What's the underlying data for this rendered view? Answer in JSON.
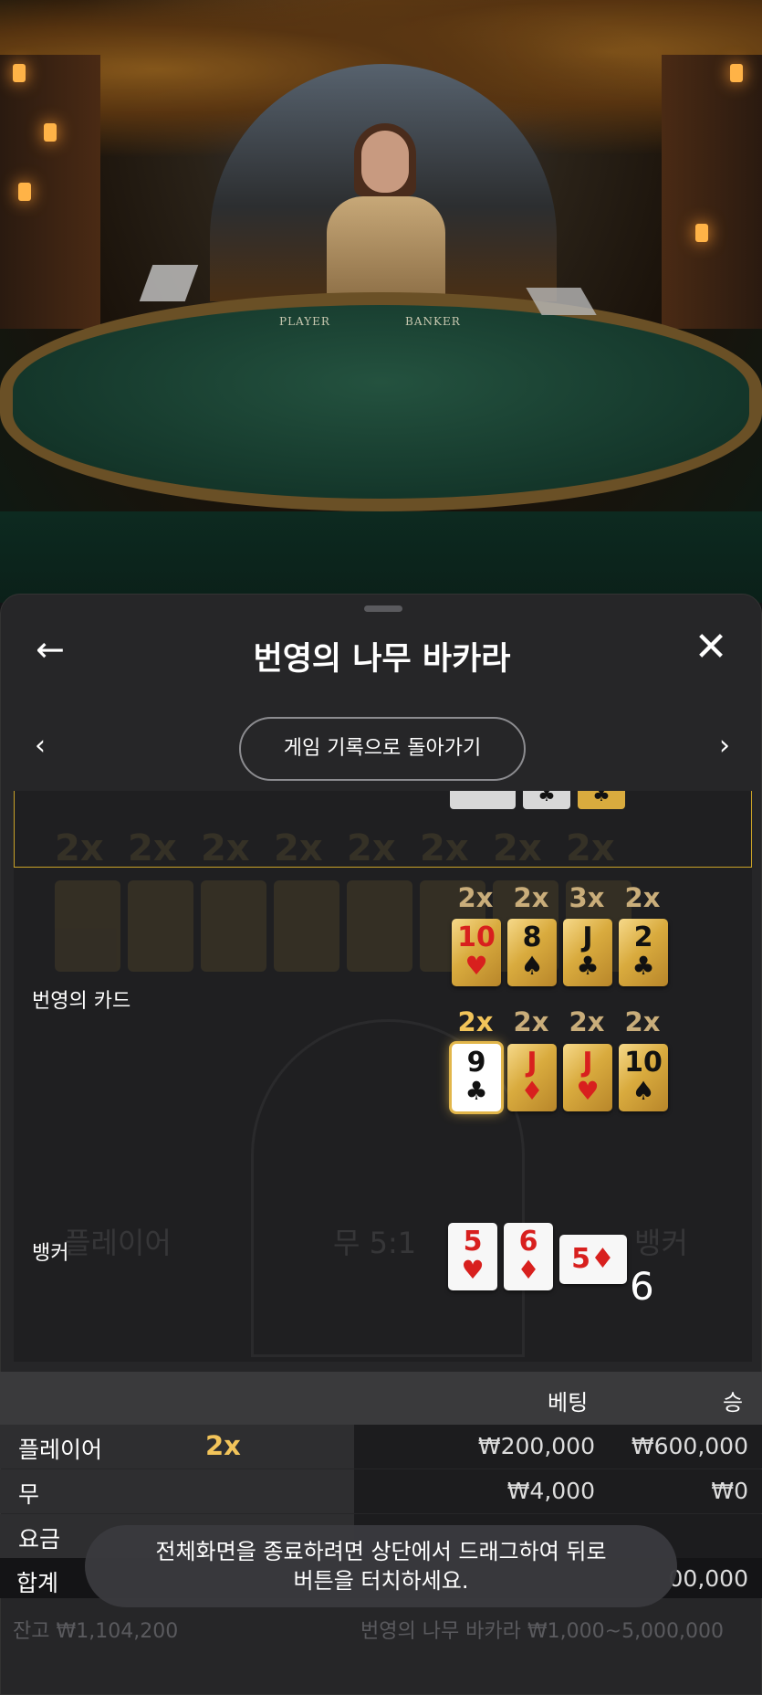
{
  "video": {
    "player_label": "PLAYER",
    "banker_label": "BANKER"
  },
  "header": {
    "back_icon": "←",
    "title": "번영의 나무 바카라",
    "close_icon": "✕"
  },
  "nav": {
    "prev_icon": "‹",
    "next_icon": "›",
    "back_to_history": "게임 기록으로 돌아가기"
  },
  "round": {
    "prosperity_label": "번영의 카드",
    "prosperity_row1": [
      {
        "mult": "2x",
        "rank": "10",
        "suit": "♥",
        "color": "red"
      },
      {
        "mult": "2x",
        "rank": "8",
        "suit": "♠",
        "color": "blk"
      },
      {
        "mult": "3x",
        "rank": "J",
        "suit": "♣",
        "color": "blk"
      },
      {
        "mult": "2x",
        "rank": "2",
        "suit": "♣",
        "color": "blk"
      }
    ],
    "prosperity_row2": [
      {
        "mult": "2x",
        "rank": "9",
        "suit": "♣",
        "color": "blk"
      },
      {
        "mult": "2x",
        "rank": "J",
        "suit": "♦",
        "color": "red"
      },
      {
        "mult": "2x",
        "rank": "J",
        "suit": "♥",
        "color": "red"
      },
      {
        "mult": "2x",
        "rank": "10",
        "suit": "♠",
        "color": "blk"
      }
    ],
    "banker_label": "뱅커",
    "banker_cards": [
      {
        "rank": "5",
        "suit": "♥"
      },
      {
        "rank": "6",
        "suit": "♦"
      },
      {
        "rank": "5",
        "suit": "♦"
      }
    ],
    "banker_total": "6",
    "ghost_player": "플레이어",
    "ghost_tie": "무 5:1",
    "ghost_banker": "뱅커"
  },
  "bets": {
    "col_bet": "베팅",
    "col_win": "승",
    "rows": [
      {
        "name": "플레이어",
        "mult": "2x",
        "bet": "₩200,000",
        "win": "₩600,000"
      },
      {
        "name": "무",
        "mult": "",
        "bet": "₩4,000",
        "win": "₩0"
      },
      {
        "name": "요금",
        "mult": "",
        "bet": "",
        "win": ""
      }
    ],
    "total_label": "합계",
    "total_win": "00,000"
  },
  "footer": {
    "balance": "잔고 ₩1,104,200",
    "table_limits": "번영의 나무 바카라 ₩1,000~5,000,000"
  },
  "toast": {
    "line1": "전체화면을 종료하려면 상단에서 드래그하여 뒤로",
    "line2": "버튼을 터치하세요."
  }
}
